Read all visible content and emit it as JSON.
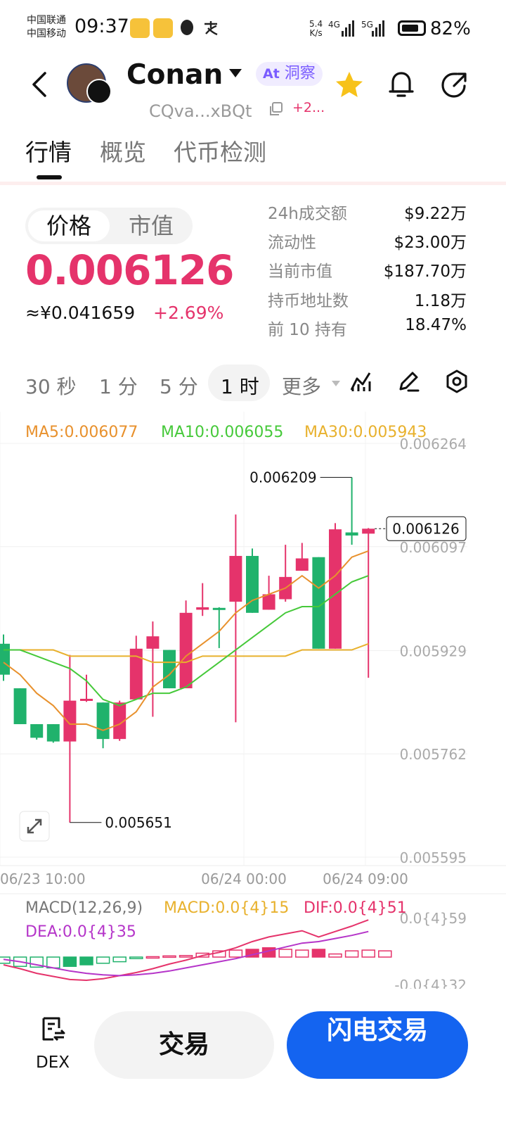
{
  "status_bar": {
    "carrier_1": "中国联通",
    "carrier_2": "中国移动",
    "time": "09:37",
    "net_speed_value": "5.4",
    "net_speed_unit": "K/s",
    "sig1": "4G",
    "sig2": "5G",
    "battery": "82%",
    "battery_level": 0.82
  },
  "header": {
    "token_name": "Conan",
    "ai_badge_icon": "At",
    "ai_badge": "洞察",
    "address": "CQva...xBQt",
    "extra_count": "+2...",
    "accent": "#e5336b"
  },
  "tabs": [
    {
      "label": "行情",
      "active": true
    },
    {
      "label": "概览",
      "active": false
    },
    {
      "label": "代币检测",
      "active": false
    }
  ],
  "price_panel": {
    "toggle": [
      "价格",
      "市值"
    ],
    "price": "0.006126",
    "cny_price": "≈¥0.041659",
    "change": "+2.69%",
    "stats": [
      {
        "label": "24h成交额",
        "value": "$9.22万"
      },
      {
        "label": "流动性",
        "value": "$23.00万"
      },
      {
        "label": "当前市值",
        "value": "$187.70万"
      },
      {
        "label": "持币地址数",
        "value": "1.18万"
      },
      {
        "label": "前 10 持有",
        "value": "18.47%"
      }
    ]
  },
  "timeframes": {
    "items": [
      "30 秒",
      "1 分",
      "5 分",
      "1 时"
    ],
    "active": "1 时",
    "more": "更多"
  },
  "chart_data": {
    "type": "candlestick",
    "ma_legend": {
      "ma5": "MA5:0.006077",
      "ma10": "MA10:0.006055",
      "ma30": "MA30:0.005943"
    },
    "y_ticks": [
      "0.006264",
      "0.006097",
      "0.005929",
      "0.005762",
      "0.005595"
    ],
    "ylim": [
      0.005595,
      0.006264
    ],
    "x_ticks": [
      "06/23 10:00",
      "06/24 00:00",
      "06/24 09:00"
    ],
    "high_label": "0.006209",
    "low_label": "0.005651",
    "last_price": "0.006126",
    "colors": {
      "up": "#e5336b",
      "down": "#20b26c",
      "ma5": "#e8912d",
      "ma10": "#46c93a",
      "ma30": "#e8b12d"
    },
    "candles": [
      {
        "o": 0.00594,
        "h": 0.005955,
        "l": 0.00588,
        "c": 0.00589
      },
      {
        "o": 0.005868,
        "h": 0.005868,
        "l": 0.00581,
        "c": 0.00581
      },
      {
        "o": 0.00581,
        "h": 0.00581,
        "l": 0.005785,
        "c": 0.005788
      },
      {
        "o": 0.00581,
        "h": 0.00581,
        "l": 0.00578,
        "c": 0.005782
      },
      {
        "o": 0.005782,
        "h": 0.005922,
        "l": 0.005651,
        "c": 0.005848
      },
      {
        "o": 0.005848,
        "h": 0.00589,
        "l": 0.005846,
        "c": 0.005851
      },
      {
        "o": 0.005845,
        "h": 0.005845,
        "l": 0.005771,
        "c": 0.005786
      },
      {
        "o": 0.005786,
        "h": 0.005848,
        "l": 0.005783,
        "c": 0.005845
      },
      {
        "o": 0.00585,
        "h": 0.005953,
        "l": 0.00585,
        "c": 0.005932
      },
      {
        "o": 0.005932,
        "h": 0.005976,
        "l": 0.005822,
        "c": 0.005952
      },
      {
        "o": 0.00593,
        "h": 0.00593,
        "l": 0.005868,
        "c": 0.005868
      },
      {
        "o": 0.005868,
        "h": 0.00601,
        "l": 0.005868,
        "c": 0.00599
      },
      {
        "o": 0.005995,
        "h": 0.006038,
        "l": 0.005985,
        "c": 0.005999
      },
      {
        "o": 0.005998,
        "h": 0.005999,
        "l": 0.005933,
        "c": 0.005996
      },
      {
        "o": 0.006008,
        "h": 0.006149,
        "l": 0.005813,
        "c": 0.006082
      },
      {
        "o": 0.006082,
        "h": 0.006094,
        "l": 0.00599,
        "c": 0.00599
      },
      {
        "o": 0.005995,
        "h": 0.00605,
        "l": 0.005995,
        "c": 0.00602
      },
      {
        "o": 0.006012,
        "h": 0.0061,
        "l": 0.006008,
        "c": 0.006048
      },
      {
        "o": 0.006058,
        "h": 0.006103,
        "l": 0.006058,
        "c": 0.006078
      },
      {
        "o": 0.00608,
        "h": 0.00608,
        "l": 0.005932,
        "c": 0.005932
      },
      {
        "o": 0.005932,
        "h": 0.006135,
        "l": 0.005932,
        "c": 0.006125
      },
      {
        "o": 0.00612,
        "h": 0.006209,
        "l": 0.0061,
        "c": 0.006115
      },
      {
        "o": 0.006118,
        "h": 0.006127,
        "l": 0.005885,
        "c": 0.006126
      }
    ],
    "ma5_line": [
      0.00591,
      0.00589,
      0.00586,
      0.00584,
      0.00581,
      0.00581,
      0.0058,
      0.00581,
      0.00583,
      0.00587,
      0.00589,
      0.00592,
      0.00594,
      0.00596,
      0.00599,
      0.00601,
      0.00602,
      0.00603,
      0.00605,
      0.00603,
      0.00605,
      0.00608,
      0.00609
    ],
    "ma10_line": [
      0.00593,
      0.00593,
      0.00592,
      0.00591,
      0.0059,
      0.00588,
      0.00585,
      0.00584,
      0.00585,
      0.00586,
      0.00586,
      0.00587,
      0.00589,
      0.00591,
      0.00593,
      0.00595,
      0.00597,
      0.00599,
      0.006,
      0.006,
      0.00602,
      0.00604,
      0.00605
    ],
    "ma30_line": [
      0.00593,
      0.00593,
      0.00593,
      0.00593,
      0.00592,
      0.00592,
      0.00592,
      0.00592,
      0.00592,
      0.00591,
      0.00591,
      0.00591,
      0.00592,
      0.00592,
      0.00592,
      0.00592,
      0.00592,
      0.00592,
      0.00593,
      0.00593,
      0.00593,
      0.00593,
      0.00594
    ],
    "macd_legend": {
      "title": "MACD(12,26,9)",
      "macd": "MACD:0.0{4}15",
      "dif": "DIF:0.0{4}51",
      "dea": "DEA:0.0{4}35"
    },
    "macd_ticks": [
      "0.0{4}59",
      "-0.0{4}32"
    ],
    "macd_hist": [
      -0.8,
      -1.2,
      -1.3,
      -1.4,
      -1.2,
      -1.0,
      -0.8,
      -0.6,
      -0.2,
      0.05,
      0.15,
      0.2,
      0.5,
      0.8,
      0.9,
      1.0,
      1.2,
      1.0,
      0.9,
      1.0,
      0.4,
      0.8,
      0.9,
      0.8
    ],
    "dif_line": [
      -1.0,
      -1.5,
      -2.1,
      -2.5,
      -2.9,
      -3.0,
      -2.8,
      -2.4,
      -2.0,
      -1.5,
      -0.9,
      -0.4,
      0.2,
      0.6,
      1.2,
      2.0,
      2.6,
      3.0,
      3.4,
      2.6,
      3.3,
      4.0,
      4.8
    ],
    "dea_line": [
      -0.3,
      -0.6,
      -1.0,
      -1.4,
      -1.8,
      -2.1,
      -2.3,
      -2.4,
      -2.3,
      -2.1,
      -1.8,
      -1.4,
      -1.0,
      -0.6,
      -0.2,
      0.3,
      0.8,
      1.3,
      1.8,
      2.0,
      2.4,
      2.8,
      3.3
    ]
  },
  "bottom_bar": {
    "dex_label": "DEX",
    "trade": "交易",
    "flash_trade": "闪电交易"
  }
}
